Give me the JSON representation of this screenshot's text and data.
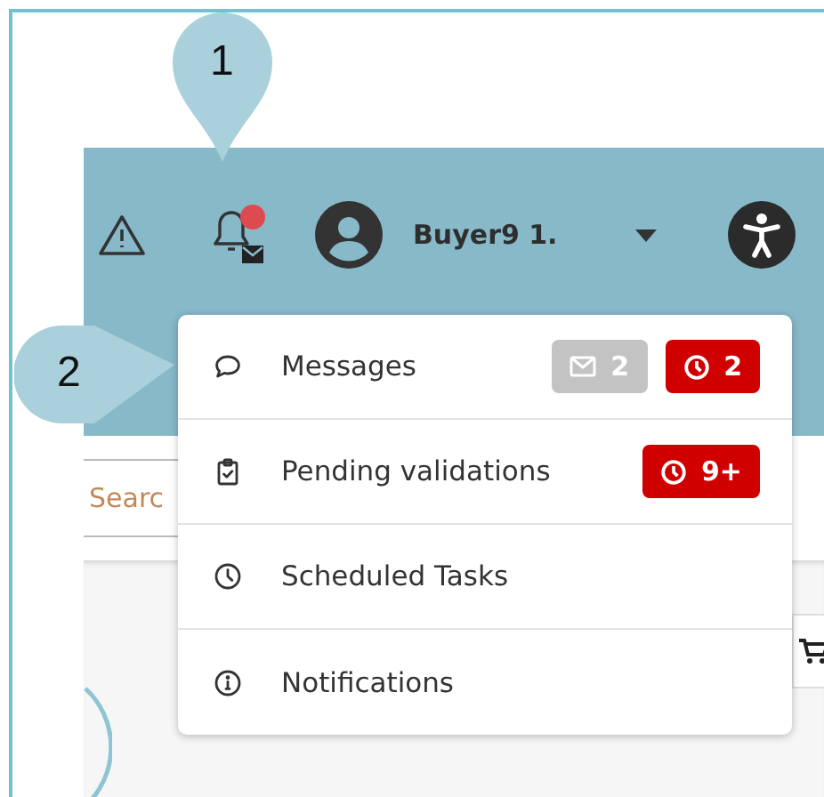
{
  "callouts": [
    {
      "label": "1"
    },
    {
      "label": "2"
    }
  ],
  "header": {
    "notification_dot": true,
    "user_name": "Buyer9 1."
  },
  "search": {
    "placeholder": "Searc"
  },
  "menu": {
    "items": [
      {
        "label": "Messages",
        "badges": [
          {
            "kind": "mail",
            "text": "2"
          },
          {
            "kind": "clock",
            "text": "2"
          }
        ]
      },
      {
        "label": "Pending validations",
        "badges": [
          {
            "kind": "clock",
            "text": "9+"
          }
        ]
      },
      {
        "label": "Scheduled Tasks"
      },
      {
        "label": "Notifications"
      }
    ]
  }
}
